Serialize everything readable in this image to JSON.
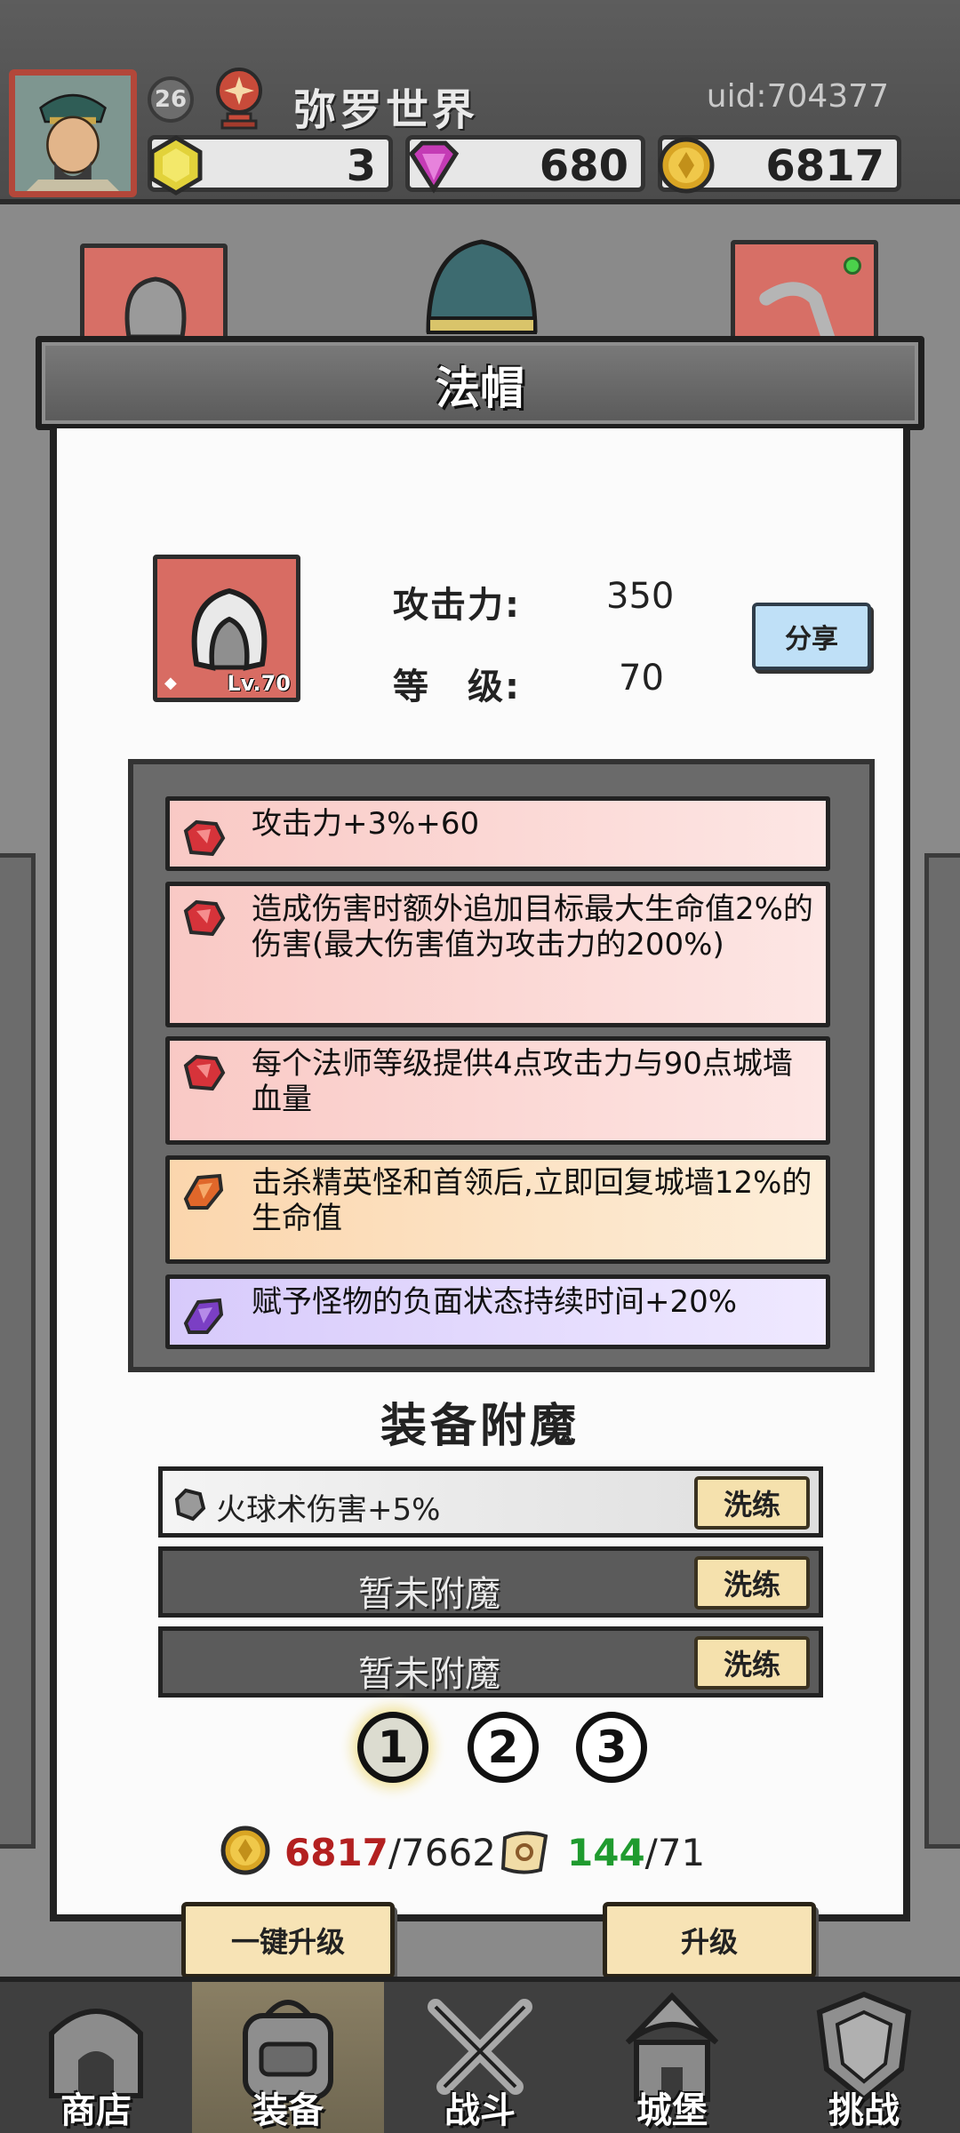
{
  "player": {
    "level": "26",
    "name": "弥罗世界",
    "uid": "uid:704377"
  },
  "resources": {
    "gold_gem": "3",
    "diamond": "680",
    "coin": "6817"
  },
  "dialog": {
    "title": "法帽",
    "item_level": "Lv.70",
    "attack_label": "攻击力:",
    "attack_value": "350",
    "level_label": "等　级:",
    "level_value": "70",
    "share_label": "分享"
  },
  "affixes": [
    {
      "text": "攻击力+3%+60",
      "tier": "red"
    },
    {
      "text": "造成伤害时额外追加目标最大生命值2%的伤害(最大伤害值为攻击力的200%)",
      "tier": "red"
    },
    {
      "text": "每个法师等级提供4点攻击力与90点城墙血量",
      "tier": "red"
    },
    {
      "text": "击杀精英怪和首领后,立即回复城墙12%的生命值",
      "tier": "orange"
    },
    {
      "text": "赋予怪物的负面状态持续时间+20%",
      "tier": "purple"
    }
  ],
  "enchant": {
    "title": "装备附魔",
    "slots": [
      {
        "text": "火球术伤害+5%",
        "button": "洗练"
      },
      {
        "text": "暂未附魔",
        "button": "洗练"
      },
      {
        "text": "暂未附魔",
        "button": "洗练"
      }
    ],
    "pages": [
      "1",
      "2",
      "3"
    ]
  },
  "cost": {
    "coin_have": "6817",
    "coin_need": "/7662",
    "scroll_have": "144",
    "scroll_need": "/71"
  },
  "buttons": {
    "one_key_upgrade": "一键升级",
    "upgrade": "升级"
  },
  "nav": [
    {
      "label": "商店",
      "icon": "shop-icon"
    },
    {
      "label": "装备",
      "icon": "backpack-icon"
    },
    {
      "label": "战斗",
      "icon": "crossed-swords-icon"
    },
    {
      "label": "城堡",
      "icon": "castle-icon"
    },
    {
      "label": "挑战",
      "icon": "shield-icon"
    }
  ],
  "colors": {
    "item_bg": "#d86c63",
    "affix_red": "#f9c9c5",
    "affix_orange": "#fbd6ad",
    "affix_purple": "#d7cafb",
    "button_beige": "#f7e3b5",
    "share_blue": "#bfe0f7",
    "have_red": "#b32020",
    "have_green": "#1f9b2f"
  }
}
